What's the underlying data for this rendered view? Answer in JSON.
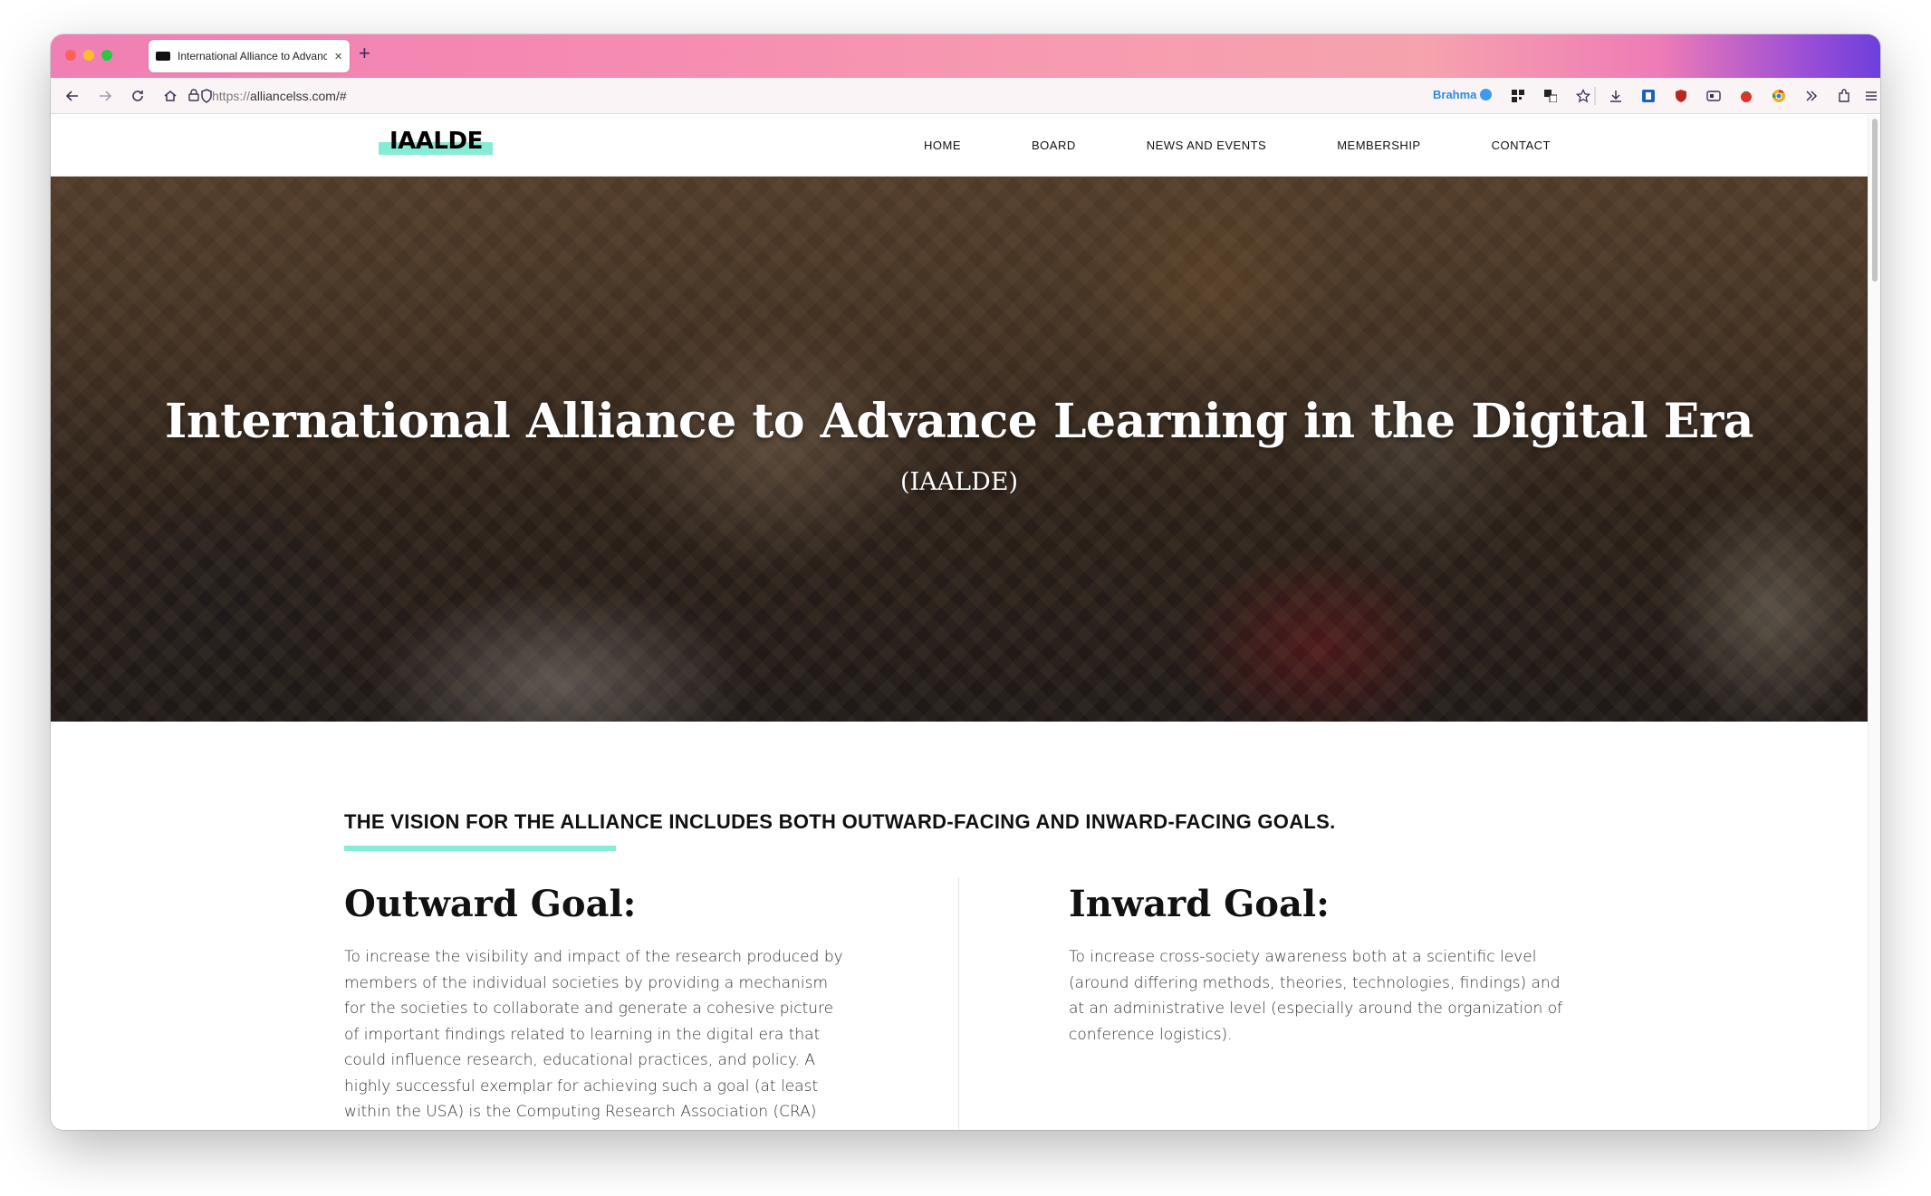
{
  "browser": {
    "tab_title": "International Alliance to Advance Learning in the Digital Era",
    "new_tab": "+",
    "close_tab": "×",
    "url_prefix": "https://",
    "url_host": "alliancelss.com/#",
    "profile_label": "Brahma",
    "accent_color": "#f58ab2"
  },
  "site": {
    "logo": "IAALDE",
    "nav": [
      "HOME",
      "BOARD",
      "NEWS AND EVENTS",
      "MEMBERSHIP",
      "CONTACT"
    ]
  },
  "hero": {
    "title": "International Alliance to Advance Learning in the Digital Era",
    "subtitle": "(IAALDE)"
  },
  "vision": {
    "heading": "THE VISION FOR THE ALLIANCE INCLUDES BOTH OUTWARD-FACING AND INWARD-FACING GOALS.",
    "accent_color": "#86ecd6",
    "outward": {
      "title": "Outward Goal:",
      "text": "To increase the visibility and impact of the research produced by members of the individual societies by providing a mechanism for the societies to collaborate and generate a cohesive picture of important findings related to learning in the digital era that could influence research, educational practices, and policy. A highly successful exemplar for achieving such a goal (at least within the USA) is the Computing Research Association (CRA) whose mission is \"to enhance innovation by joining with industry, government and academia to"
    },
    "inward": {
      "title": "Inward Goal:",
      "text": "To increase cross-society awareness both at a scientific level (around differing methods, theories, technologies, findings) and at an administrative level (especially around the organization of conference logistics)."
    }
  }
}
